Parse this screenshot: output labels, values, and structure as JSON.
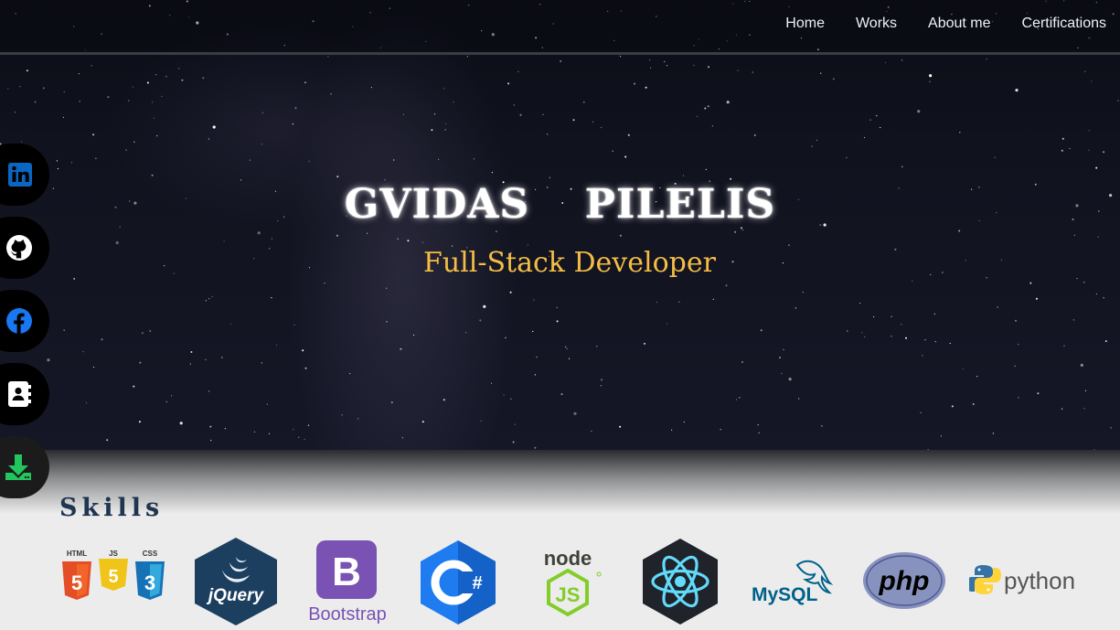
{
  "nav": {
    "items": [
      "Home",
      "Works",
      "About me",
      "Certifications"
    ]
  },
  "hero": {
    "name": "GVIDAS  PILELIS",
    "role": "Full-Stack Developer"
  },
  "social": [
    {
      "icon": "linkedin-icon",
      "color": "#0a66c2"
    },
    {
      "icon": "github-icon",
      "color": "#ffffff"
    },
    {
      "icon": "facebook-icon",
      "color": "#1877f2"
    },
    {
      "icon": "contact-card-icon",
      "color": "#ffffff"
    },
    {
      "icon": "download-icon",
      "color": "#22c55e"
    }
  ],
  "skills": {
    "heading": "Skills",
    "logos": {
      "html5": "HTML",
      "js": "JS",
      "css3": "CSS",
      "jquery": "jQuery",
      "bootstrap_letter": "B",
      "bootstrap": "Bootstrap",
      "csharp": "C",
      "csharp_sharp": "#",
      "node": "node",
      "node_js": "JS",
      "mysql": "MySQL",
      "php": "php",
      "python": "python"
    }
  },
  "colors": {
    "accent": "#f5bd43",
    "heading": "#1f3550"
  }
}
